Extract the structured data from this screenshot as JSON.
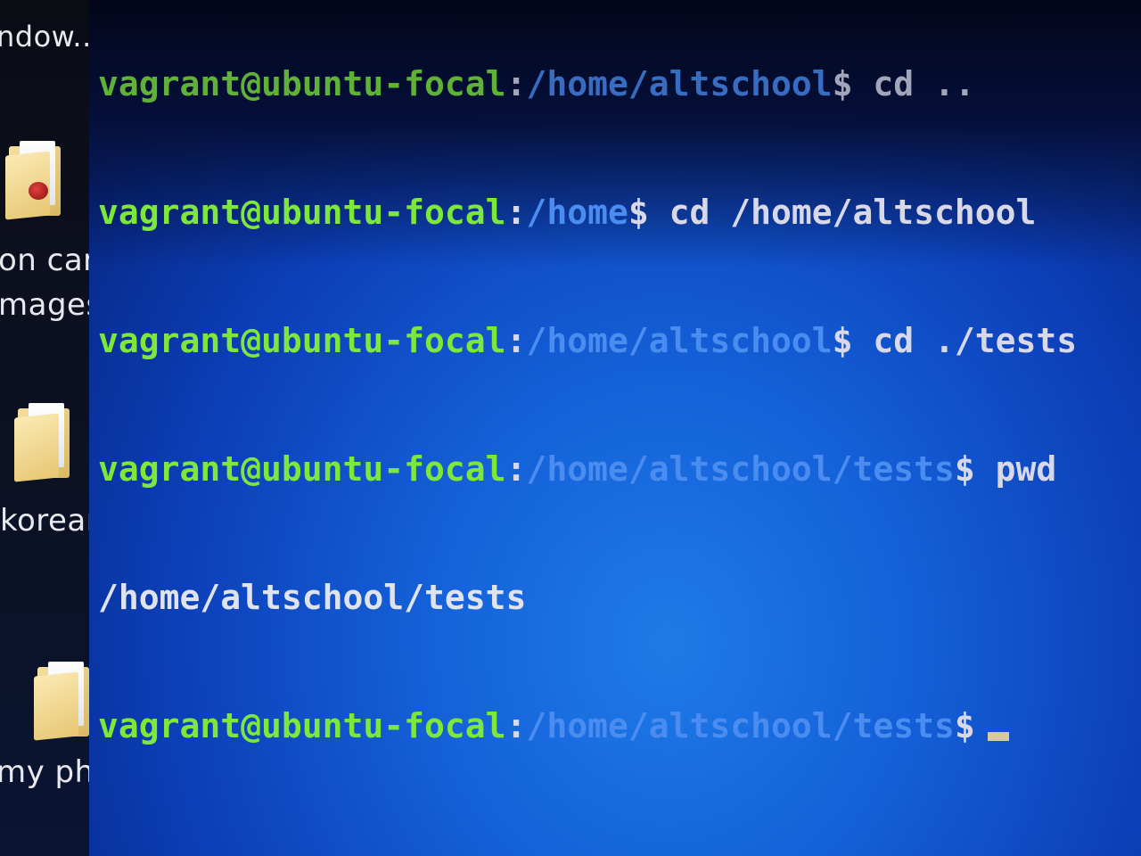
{
  "desktop": {
    "labels": {
      "top": "ndow...",
      "folder1": "on canc",
      "folder1_line2": "mages",
      "folder2": "korean",
      "folder3": "my phon"
    }
  },
  "terminal": {
    "colors": {
      "user": "#7ee83a",
      "path": "#4a8cf0",
      "text": "#d8d8e8",
      "background": "#1460d8"
    },
    "lines": [
      {
        "user": "vagrant@ubuntu-focal",
        "sep": ":",
        "path": "/home/altschool",
        "prompt": "$",
        "command": " cd .."
      },
      {
        "user": "vagrant@ubuntu-focal",
        "sep": ":",
        "path": "/home",
        "prompt": "$",
        "command": " cd /home/altschool"
      },
      {
        "user": "vagrant@ubuntu-focal",
        "sep": ":",
        "path": "/home/altschool",
        "prompt": "$",
        "command": " cd ./tests"
      },
      {
        "user": "vagrant@ubuntu-focal",
        "sep": ":",
        "path": "/home/altschool/tests",
        "prompt": "$",
        "command": " pwd"
      },
      {
        "output": "/home/altschool/tests"
      },
      {
        "user": "vagrant@ubuntu-focal",
        "sep": ":",
        "path": "/home/altschool/tests",
        "prompt": "$",
        "command": ""
      }
    ]
  }
}
